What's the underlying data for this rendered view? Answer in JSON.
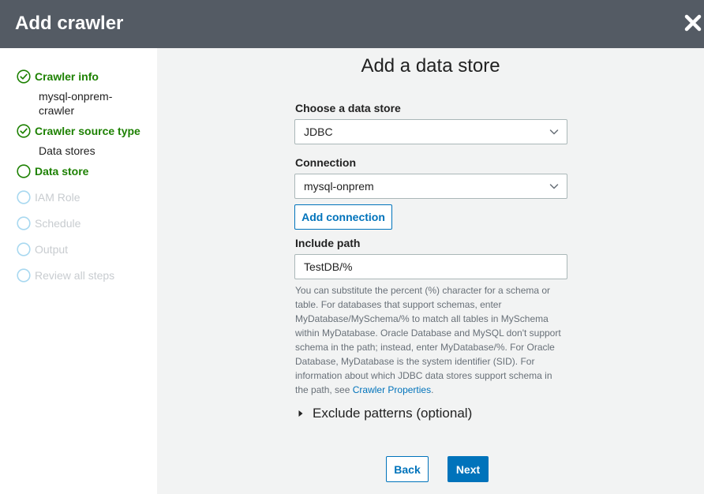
{
  "window": {
    "title": "Add crawler"
  },
  "sidebar": {
    "steps": [
      {
        "label": "Crawler info",
        "state": "complete",
        "sub": "mysql-onprem-crawler"
      },
      {
        "label": "Crawler source type",
        "state": "complete",
        "sub": "Data stores"
      },
      {
        "label": "Data store",
        "state": "current"
      },
      {
        "label": "IAM Role",
        "state": "pending"
      },
      {
        "label": "Schedule",
        "state": "pending"
      },
      {
        "label": "Output",
        "state": "pending"
      },
      {
        "label": "Review all steps",
        "state": "pending"
      }
    ]
  },
  "main": {
    "heading": "Add a data store",
    "data_store": {
      "label": "Choose a data store",
      "value": "JDBC"
    },
    "connection": {
      "label": "Connection",
      "value": "mysql-onprem",
      "add_label": "Add connection"
    },
    "include_path": {
      "label": "Include path",
      "value": "TestDB/%",
      "help": "You can substitute the percent (%) character for a schema or table. For databases that support schemas, enter MyDatabase/MySchema/% to match all tables in MySchema within MyDatabase. Oracle Database and MySQL don't support schema in the path; instead, enter MyDatabase/%. For Oracle Database, MyDatabase is the system identifier (SID). For information about which JDBC data stores support schema in the path, see",
      "help_link": "Crawler Properties",
      "help_end": "."
    },
    "exclude_patterns": {
      "label": "Exclude patterns (optional)"
    },
    "footer": {
      "back_label": "Back",
      "next_label": "Next"
    }
  },
  "colors": {
    "titlebar": "#545b64",
    "active_green": "#1d8102",
    "pending_blue": "#a8d8f0",
    "pending_text": "#c8ccd0",
    "primary": "#0073bb",
    "content_bg": "#f2f3f3"
  },
  "icons": {
    "close": "close-icon",
    "complete": "check-circle-icon",
    "current": "circle-outline-icon",
    "pending": "circle-outline-icon",
    "select": "chevron-down-icon",
    "expand": "caret-right-icon"
  }
}
